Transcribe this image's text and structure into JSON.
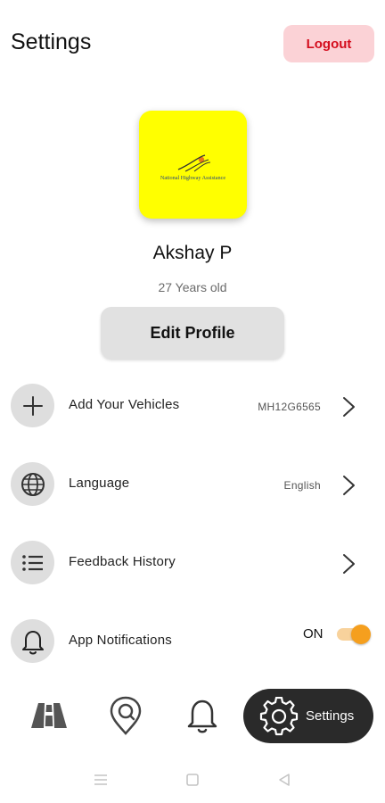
{
  "header": {
    "title": "Settings",
    "logout_label": "Logout"
  },
  "profile": {
    "logo_text": "National Highway Assistance",
    "name": "Akshay P",
    "age": "27 Years old",
    "edit_label": "Edit Profile"
  },
  "settings": {
    "items": [
      {
        "label": "Add Your Vehicles",
        "value": "MH12G6565",
        "icon": "plus-icon"
      },
      {
        "label": "Language",
        "value": "English",
        "icon": "globe-icon"
      },
      {
        "label": "Feedback History",
        "value": "",
        "icon": "list-icon"
      },
      {
        "label": "App Notifications",
        "value": "",
        "icon": "bell-icon"
      }
    ],
    "notifications_state": "ON"
  },
  "bottom_nav": {
    "items": [
      {
        "icon": "road-icon"
      },
      {
        "icon": "location-pin-icon"
      },
      {
        "icon": "bell-icon"
      },
      {
        "icon": "gear-icon",
        "label": "Settings"
      }
    ]
  },
  "colors": {
    "accent": "#f59f1e",
    "logout_bg": "#fbd2d6",
    "logout_text": "#d40d1d",
    "avatar_bg": "#ffff00",
    "nav_active_bg": "#2a2a2a"
  }
}
